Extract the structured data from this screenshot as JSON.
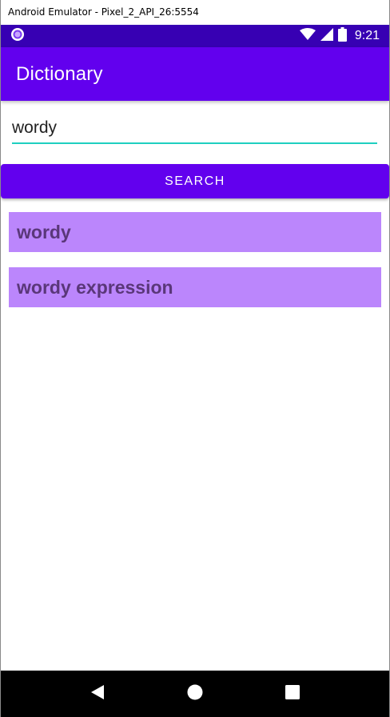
{
  "window": {
    "title": "Android Emulator - Pixel_2_API_26:5554"
  },
  "status_bar": {
    "time": "9:21",
    "icons": [
      "notification-dot-icon",
      "wifi-icon",
      "signal-icon",
      "battery-icon"
    ]
  },
  "app_bar": {
    "title": "Dictionary"
  },
  "search": {
    "value": "wordy",
    "button_label": "SEARCH"
  },
  "results": [
    {
      "label": "wordy"
    },
    {
      "label": "wordy expression"
    }
  ],
  "nav_bar": {
    "icons": [
      "back-icon",
      "home-icon",
      "recents-icon"
    ]
  },
  "colors": {
    "primary": "#6200ee",
    "primary_dark": "#3700b3",
    "accent": "#1fcfc0",
    "result_background": "#bb86fc",
    "result_text": "#5a3779"
  }
}
